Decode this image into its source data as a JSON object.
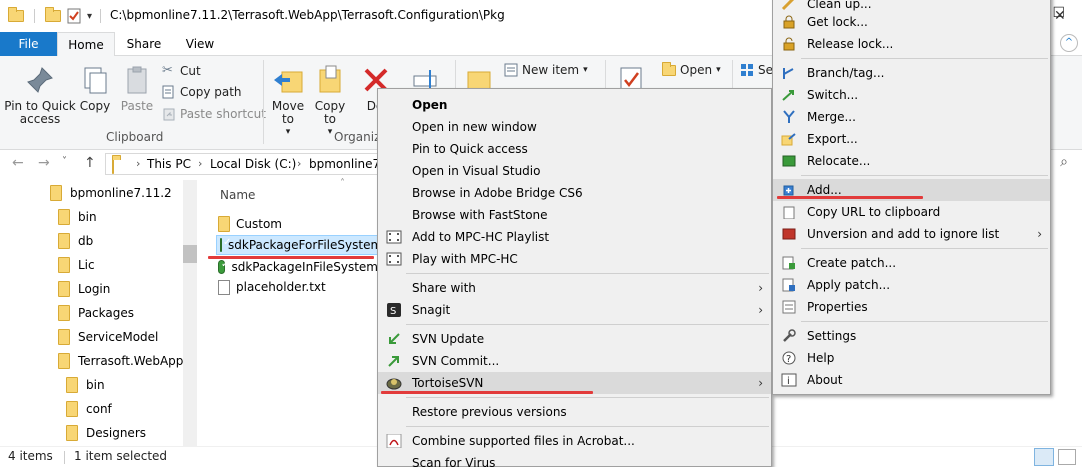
{
  "window": {
    "title_path": "C:\\bpmonline7.11.2\\Terrasoft.WebApp\\Terrasoft.Configuration\\Pkg"
  },
  "ribbon": {
    "tabs": [
      "File",
      "Home",
      "Share",
      "View"
    ],
    "clipboard": {
      "pin_label": "Pin to Quick access",
      "copy_label": "Copy",
      "paste_label": "Paste",
      "cut_label": "Cut",
      "copy_path_label": "Copy path",
      "paste_shortcut_label": "Paste shortcut",
      "group_label": "Clipboard"
    },
    "organize": {
      "move_to_label": "Move to",
      "copy_to_label": "Copy to",
      "delete_label": "De",
      "group_label": "Organiz"
    },
    "new": {
      "new_item_label": "New item"
    },
    "open": {
      "open_label": "Open",
      "select_label": "Se"
    }
  },
  "address": {
    "crumbs": [
      "This PC",
      "Local Disk (C:)",
      "bpmonline7."
    ]
  },
  "nav_tree": [
    {
      "label": "bpmonline7.11.2"
    },
    {
      "label": "bin"
    },
    {
      "label": "db"
    },
    {
      "label": "Lic"
    },
    {
      "label": "Login"
    },
    {
      "label": "Packages"
    },
    {
      "label": "ServiceModel"
    },
    {
      "label": "Terrasoft.WebApp"
    },
    {
      "label": "bin"
    },
    {
      "label": "conf"
    },
    {
      "label": "Designers"
    }
  ],
  "file_list": {
    "column_name": "Name",
    "items": [
      {
        "label": "Custom",
        "icon": "folder-icon"
      },
      {
        "label": "sdkPackageForFileSystem",
        "icon": "svn-ok-icon",
        "selected": true
      },
      {
        "label": "sdkPackageInFileSystem",
        "icon": "svn-ok-icon"
      },
      {
        "label": "placeholder.txt",
        "icon": "text-file-icon"
      }
    ]
  },
  "status": {
    "items_count": "4 items",
    "selected_count": "1 item selected"
  },
  "context_menu": {
    "items": [
      {
        "label": "Open"
      },
      {
        "label": "Open in new window"
      },
      {
        "label": "Pin to Quick access"
      },
      {
        "label": "Open in Visual Studio"
      },
      {
        "label": "Browse in Adobe Bridge CS6"
      },
      {
        "label": "Browse with FastStone"
      },
      {
        "label": "Add to MPC-HC Playlist"
      },
      {
        "label": "Play with MPC-HC"
      },
      {
        "label": "Share with"
      },
      {
        "label": "Snagit"
      },
      {
        "label": "SVN Update"
      },
      {
        "label": "SVN Commit..."
      },
      {
        "label": "TortoiseSVN"
      },
      {
        "label": "Restore previous versions"
      },
      {
        "label": "Combine supported files in Acrobat..."
      },
      {
        "label": "Scan for Virus"
      }
    ]
  },
  "tortoise_menu": {
    "items": [
      {
        "label": "Clean up..."
      },
      {
        "label": "Get lock..."
      },
      {
        "label": "Release lock..."
      },
      {
        "label": "Branch/tag..."
      },
      {
        "label": "Switch..."
      },
      {
        "label": "Merge..."
      },
      {
        "label": "Export..."
      },
      {
        "label": "Relocate..."
      },
      {
        "label": "Add..."
      },
      {
        "label": "Copy URL to clipboard"
      },
      {
        "label": "Unversion and add to ignore list"
      },
      {
        "label": "Create patch..."
      },
      {
        "label": "Apply patch..."
      },
      {
        "label": "Properties"
      },
      {
        "label": "Settings"
      },
      {
        "label": "Help"
      },
      {
        "label": "About"
      }
    ]
  },
  "colors": {
    "accent_blue": "#1979ca",
    "selection": "#cce8ff",
    "highlight_underline": "#e23b3b"
  }
}
